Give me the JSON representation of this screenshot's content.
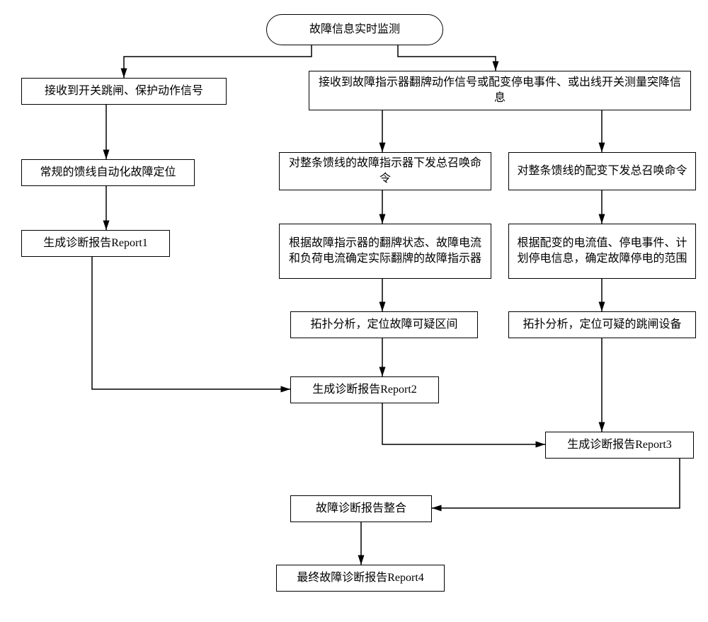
{
  "chart_data": {
    "type": "flowchart",
    "start": "故障信息实时监测",
    "branches": {
      "left": {
        "trigger": "接收到开关跳闸、保护动作信号",
        "steps": [
          "常规的馈线自动化故障定位",
          "生成诊断报告Report1"
        ]
      },
      "right_trigger": "接收到故障指示器翻牌动作信号或配变停电事件、或出线开关测量突降信息",
      "middle": {
        "steps": [
          "对整条馈线的故障指示器下发总召唤命令",
          "根据故障指示器的翻牌状态、故障电流和负荷电流确定实际翻牌的故障指示器",
          "拓扑分析，定位故障可疑区间",
          "生成诊断报告Report2"
        ]
      },
      "right": {
        "steps": [
          "对整条馈线的配变下发总召唤命令",
          "根据配变的电流值、停电事件、计划停电信息，确定故障停电的范围",
          "拓扑分析，定位可疑的跳闸设备",
          "生成诊断报告Report3"
        ]
      }
    },
    "merge": [
      "故障诊断报告整合",
      "最终故障诊断报告Report4"
    ]
  },
  "nodes": {
    "start": "故障信息实时监测",
    "l1": "接收到开关跳闸、保护动作信号",
    "l2": "常规的馈线自动化故障定位",
    "l3": "生成诊断报告Report1",
    "rTrig": "接收到故障指示器翻牌动作信号或配变停电事件、或出线开关测量突降信息",
    "m1": "对整条馈线的故障指示器下发总召唤命令",
    "m2": "根据故障指示器的翻牌状态、故障电流和负荷电流确定实际翻牌的故障指示器",
    "m3": "拓扑分析，定位故障可疑区间",
    "m4": "生成诊断报告Report2",
    "r1": "对整条馈线的配变下发总召唤命令",
    "r2": "根据配变的电流值、停电事件、计划停电信息，确定故障停电的范围",
    "r3": "拓扑分析，定位可疑的跳闸设备",
    "r4": "生成诊断报告Report3",
    "merge1": "故障诊断报告整合",
    "merge2": "最终故障诊断报告Report4"
  }
}
